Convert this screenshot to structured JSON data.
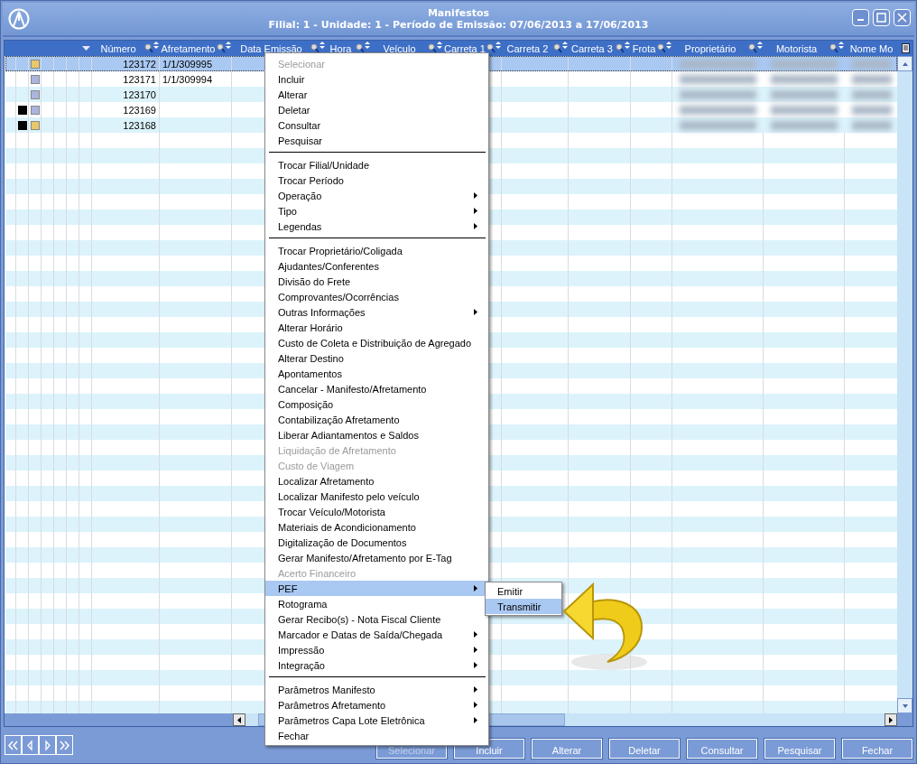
{
  "window": {
    "title": "Manifestos",
    "subtitle": "Filial: 1 - Unidade: 1 - Período de Emissão: 07/06/2013 a 17/06/2013"
  },
  "columns": [
    "Número",
    "Afretamento",
    "Data Emissão",
    "Hora",
    "Veículo",
    "Carreta 1",
    "Carreta 2",
    "Carreta 3",
    "Frota",
    "Proprietário",
    "Motorista",
    "Nome Mo"
  ],
  "rows": [
    {
      "number": "123172",
      "afretamento": "1/1/309995",
      "marked": false,
      "color": "#e8c86a",
      "redacted": true,
      "selected": true
    },
    {
      "number": "123171",
      "afretamento": "1/1/309994",
      "marked": false,
      "color": "#aab4dc",
      "redacted": true,
      "selected": false
    },
    {
      "number": "123170",
      "marked": false,
      "color": "#aab4dc",
      "redacted": true,
      "selected": false
    },
    {
      "number": "123169",
      "marked": true,
      "color": "#aab4dc",
      "redacted": true,
      "selected": false
    },
    {
      "number": "123168",
      "marked": true,
      "color": "#e8c86a",
      "redacted": true,
      "selected": false
    }
  ],
  "context_menu": [
    {
      "kind": "item",
      "label": "Selecionar",
      "disabled": true,
      "submenu": false,
      "selected": false
    },
    {
      "kind": "item",
      "label": "Incluir",
      "disabled": false,
      "submenu": false,
      "selected": false
    },
    {
      "kind": "item",
      "label": "Alterar",
      "disabled": false,
      "submenu": false,
      "selected": false
    },
    {
      "kind": "item",
      "label": "Deletar",
      "disabled": false,
      "submenu": false,
      "selected": false
    },
    {
      "kind": "item",
      "label": "Consultar",
      "disabled": false,
      "submenu": false,
      "selected": false
    },
    {
      "kind": "item",
      "label": "Pesquisar",
      "disabled": false,
      "submenu": false,
      "selected": false
    },
    {
      "kind": "separator"
    },
    {
      "kind": "item",
      "label": "Trocar Filial/Unidade",
      "disabled": false,
      "submenu": false,
      "selected": false
    },
    {
      "kind": "item",
      "label": "Trocar Período",
      "disabled": false,
      "submenu": false,
      "selected": false
    },
    {
      "kind": "item",
      "label": "Operação",
      "disabled": false,
      "submenu": true,
      "selected": false
    },
    {
      "kind": "item",
      "label": "Tipo",
      "disabled": false,
      "submenu": true,
      "selected": false
    },
    {
      "kind": "item",
      "label": "Legendas",
      "disabled": false,
      "submenu": true,
      "selected": false
    },
    {
      "kind": "separator"
    },
    {
      "kind": "item",
      "label": "Trocar Proprietário/Coligada",
      "disabled": false,
      "submenu": false,
      "selected": false
    },
    {
      "kind": "item",
      "label": "Ajudantes/Conferentes",
      "disabled": false,
      "submenu": false,
      "selected": false
    },
    {
      "kind": "item",
      "label": "Divisão do Frete",
      "disabled": false,
      "submenu": false,
      "selected": false
    },
    {
      "kind": "item",
      "label": "Comprovantes/Ocorrências",
      "disabled": false,
      "submenu": false,
      "selected": false
    },
    {
      "kind": "item",
      "label": "Outras Informações",
      "disabled": false,
      "submenu": true,
      "selected": false
    },
    {
      "kind": "item",
      "label": "Alterar Horário",
      "disabled": false,
      "submenu": false,
      "selected": false
    },
    {
      "kind": "item",
      "label": "Custo de Coleta e Distribuição de Agregado",
      "disabled": false,
      "submenu": false,
      "selected": false
    },
    {
      "kind": "item",
      "label": "Alterar Destino",
      "disabled": false,
      "submenu": false,
      "selected": false
    },
    {
      "kind": "item",
      "label": "Apontamentos",
      "disabled": false,
      "submenu": false,
      "selected": false
    },
    {
      "kind": "item",
      "label": "Cancelar - Manifesto/Afretamento",
      "disabled": false,
      "submenu": false,
      "selected": false
    },
    {
      "kind": "item",
      "label": "Composição",
      "disabled": false,
      "submenu": false,
      "selected": false
    },
    {
      "kind": "item",
      "label": "Contabilização Afretamento",
      "disabled": false,
      "submenu": false,
      "selected": false
    },
    {
      "kind": "item",
      "label": "Liberar Adiantamentos e Saldos",
      "disabled": false,
      "submenu": false,
      "selected": false
    },
    {
      "kind": "item",
      "label": "Liquidação de Afretamento",
      "disabled": true,
      "submenu": false,
      "selected": false
    },
    {
      "kind": "item",
      "label": "Custo de Viagem",
      "disabled": true,
      "submenu": false,
      "selected": false
    },
    {
      "kind": "item",
      "label": "Localizar Afretamento",
      "disabled": false,
      "submenu": false,
      "selected": false
    },
    {
      "kind": "item",
      "label": "Localizar Manifesto pelo veículo",
      "disabled": false,
      "submenu": false,
      "selected": false
    },
    {
      "kind": "item",
      "label": "Trocar Veículo/Motorista",
      "disabled": false,
      "submenu": false,
      "selected": false
    },
    {
      "kind": "item",
      "label": "Materiais de Acondicionamento",
      "disabled": false,
      "submenu": false,
      "selected": false
    },
    {
      "kind": "item",
      "label": "Digitalização de Documentos",
      "disabled": false,
      "submenu": false,
      "selected": false
    },
    {
      "kind": "item",
      "label": "Gerar Manifesto/Afretamento por E-Tag",
      "disabled": false,
      "submenu": false,
      "selected": false
    },
    {
      "kind": "item",
      "label": "Acerto Financeiro",
      "disabled": true,
      "submenu": false,
      "selected": false
    },
    {
      "kind": "item",
      "label": "PEF",
      "disabled": false,
      "submenu": true,
      "selected": true
    },
    {
      "kind": "item",
      "label": "Rotograma",
      "disabled": false,
      "submenu": false,
      "selected": false
    },
    {
      "kind": "item",
      "label": "Gerar Recibo(s) - Nota Fiscal Cliente",
      "disabled": false,
      "submenu": false,
      "selected": false
    },
    {
      "kind": "item",
      "label": "Marcador e Datas de Saída/Chegada",
      "disabled": false,
      "submenu": true,
      "selected": false
    },
    {
      "kind": "item",
      "label": "Impressão",
      "disabled": false,
      "submenu": true,
      "selected": false
    },
    {
      "kind": "item",
      "label": "Integração",
      "disabled": false,
      "submenu": true,
      "selected": false
    },
    {
      "kind": "separator"
    },
    {
      "kind": "item",
      "label": "Parâmetros Manifesto",
      "disabled": false,
      "submenu": true,
      "selected": false
    },
    {
      "kind": "item",
      "label": "Parâmetros Afretamento",
      "disabled": false,
      "submenu": true,
      "selected": false
    },
    {
      "kind": "item",
      "label": "Parâmetros Capa Lote Eletrônica",
      "disabled": false,
      "submenu": true,
      "selected": false
    },
    {
      "kind": "item",
      "label": "Fechar",
      "disabled": false,
      "submenu": false,
      "selected": false
    }
  ],
  "submenu": [
    {
      "label": "Emitir",
      "selected": false
    },
    {
      "label": "Transmitir",
      "selected": true
    }
  ],
  "footer_buttons": [
    {
      "label": "Selecionar",
      "disabled": true
    },
    {
      "label": "Incluir",
      "disabled": false
    },
    {
      "label": "Alterar",
      "disabled": false
    },
    {
      "label": "Deletar",
      "disabled": false
    },
    {
      "label": "Consultar",
      "disabled": false
    },
    {
      "label": "Pesquisar",
      "disabled": false
    },
    {
      "label": "Fechar",
      "disabled": false
    }
  ]
}
